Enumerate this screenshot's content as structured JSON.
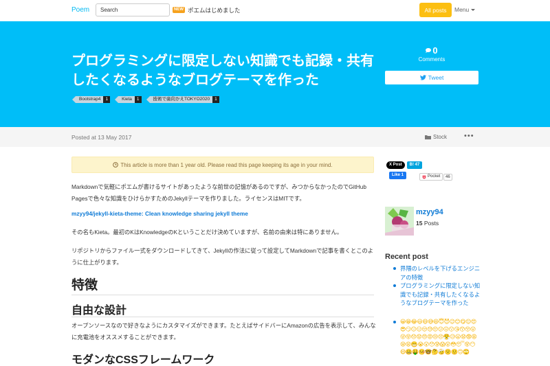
{
  "nav": {
    "brand": "Poem",
    "search_placeholder": "Search",
    "new_badge": "NEW",
    "news_text": "ポエムはじめました",
    "all_posts": "All posts",
    "menu": "Menu"
  },
  "hero": {
    "title": "プログラミングに限定しない知識でも記録・共有したくなるようなブログテーマを作った",
    "tags": [
      {
        "name": "Bootstrap4",
        "count": "1"
      },
      {
        "name": "Kieta",
        "count": "1"
      },
      {
        "name": "技術で歯向かえTOKYO2020",
        "count": "1"
      }
    ],
    "comments_count": "0",
    "comments_label": "Comments",
    "tweet": "Tweet"
  },
  "meta": {
    "posted": "Posted at 13 May 2017",
    "stock": "Stock",
    "more": "•••"
  },
  "article": {
    "alert": "This article is more than 1 year old. Please read this page keeping its age in your mind.",
    "p1": "Markdownで気軽にポエムが書けるサイトがあったような前世の記憶があるのですが、みつからなかったのでGitHub Pagesで色々な知識をひけらかすためのJekyllテーマを作りました。ライセンスはMITです。",
    "repo_link": "mzyy94/jekyll-kieta-theme: Clean knowledge sharing jekyll theme",
    "p2": "その名もKieta。最初のKはKnowledgeのKということだけ決めていますが、名前の由来は特にありません。",
    "p3": "リポジトリからファイル一式をダウンロードしてきて、Jekyllの作法に従って設定してMarkdownで記事を書くとこのように仕上がります。",
    "h_features": "特徴",
    "h_free": "自由な設計",
    "p4": "オープンソースなので好きなようにカスタマイズができます。たとえばサイドバーにAmazonの広告を表示して、みんなに充電池をオススメすることができます。",
    "h_css": "モダンなCSSフレームワーク"
  },
  "sidebar": {
    "x_post": "X Post",
    "hatena": "B! 47",
    "fb_like": "Like 1",
    "pocket": "Pocket",
    "pocket_count": "46",
    "author_name": "mzyy94",
    "author_posts_count": "15",
    "author_posts_label": "Posts",
    "recent_heading": "Recent post",
    "recent_posts": [
      "界隈のレベルを下げるエンジニアの特徴",
      "プログラミングに限定しない知識でも記録・共有したくなるようなブログテーマを作った"
    ],
    "emoji_post": "😀😁😂😃😄😅😆😇😈😉😊😋😌😍😎😏😐😑😒😓😔😕😖😗😘😙😚😛😜😝😞😟😠😡😢😣😤😥😦😧😨😩😪😫😬😭😮😯😰😱😲😳😴😵😶😷🤐🤑🤒🤓🤔🤕🙁🙂🙃🙄"
  },
  "colors": {
    "brand": "#00b9f2",
    "hero_bg": "#00bef8",
    "accent": "#fcbf12",
    "link": "#0f7bd6"
  }
}
